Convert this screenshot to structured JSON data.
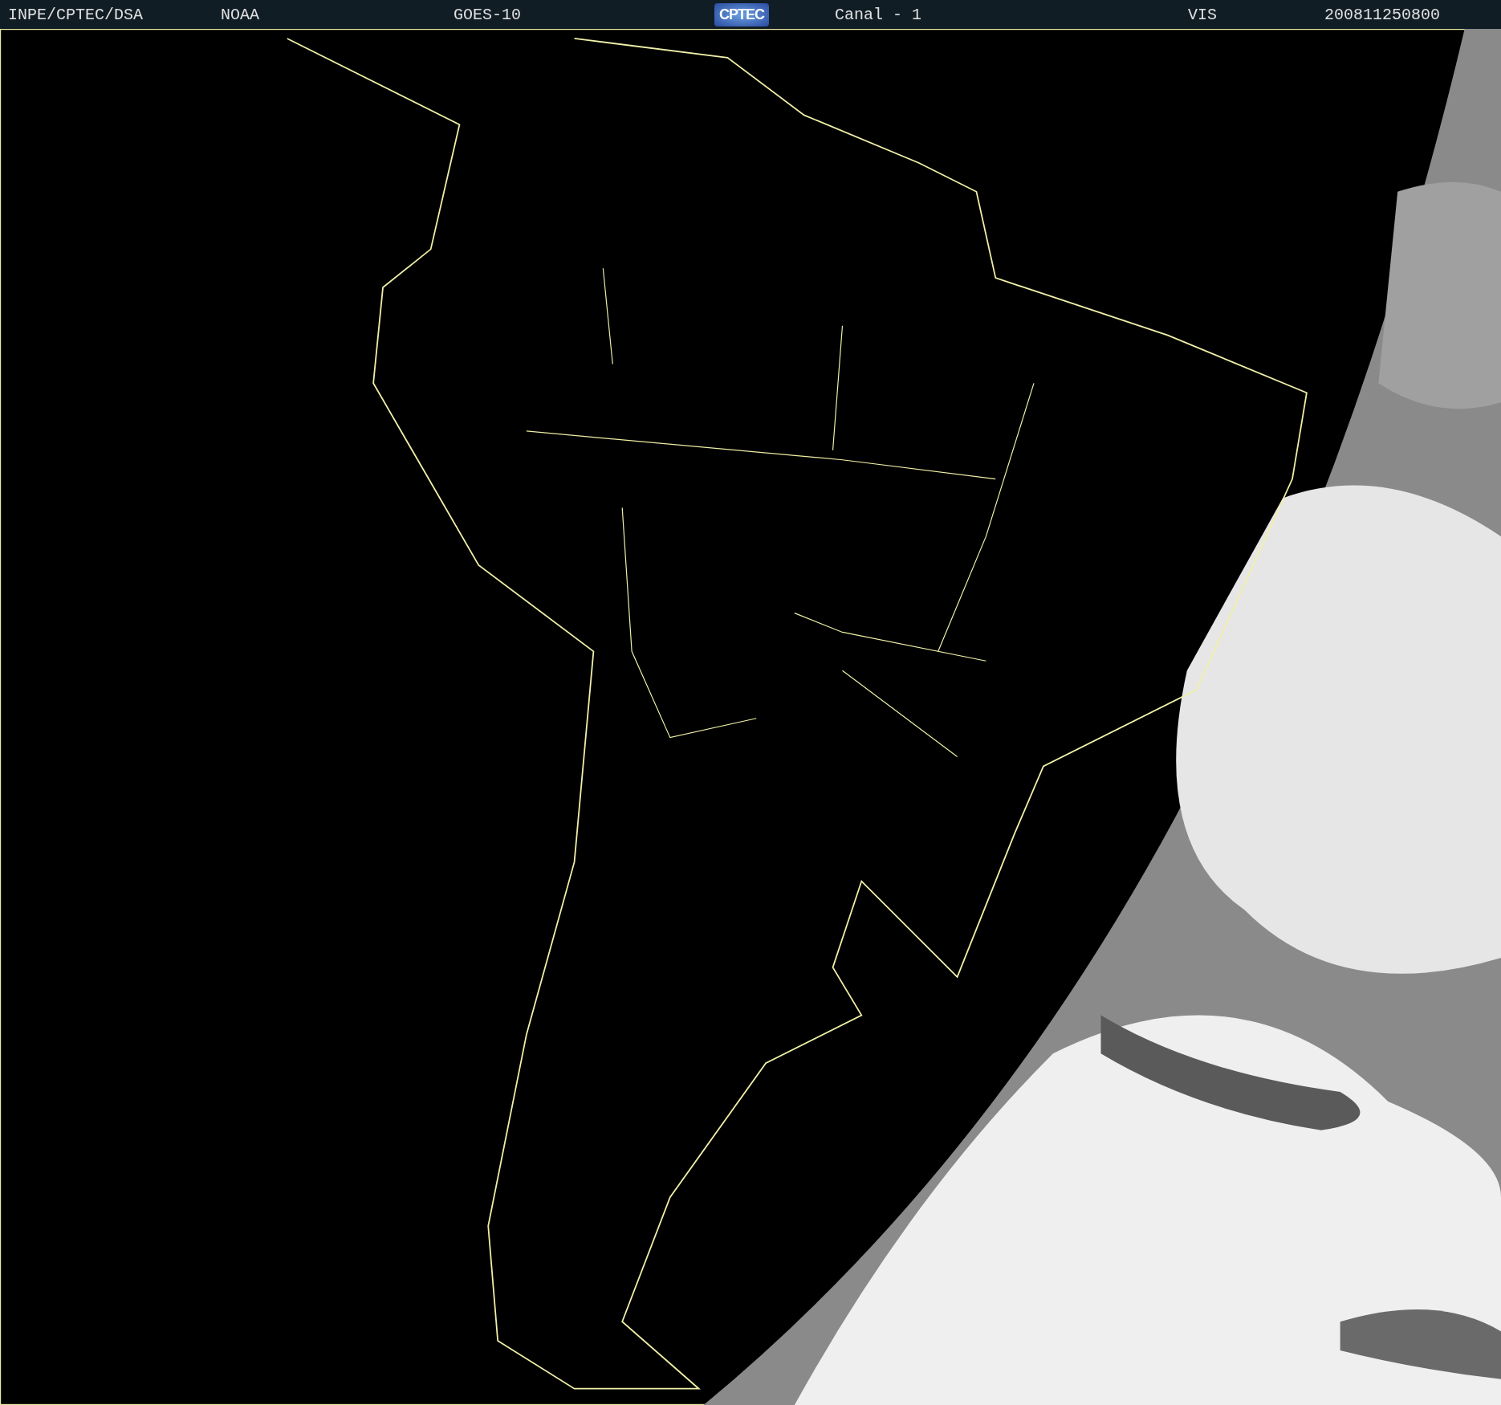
{
  "header": {
    "items": [
      {
        "kind": "text",
        "text": "INPE/CPTEC/DSA"
      },
      {
        "kind": "text",
        "text": "NOAA"
      },
      {
        "kind": "text",
        "text": "GOES-10"
      },
      {
        "kind": "logo",
        "text": "CPTEC"
      },
      {
        "kind": "text",
        "text": "Canal - 1"
      },
      {
        "kind": "text",
        "text": "VIS"
      },
      {
        "kind": "text",
        "text": "200811250800"
      }
    ]
  }
}
